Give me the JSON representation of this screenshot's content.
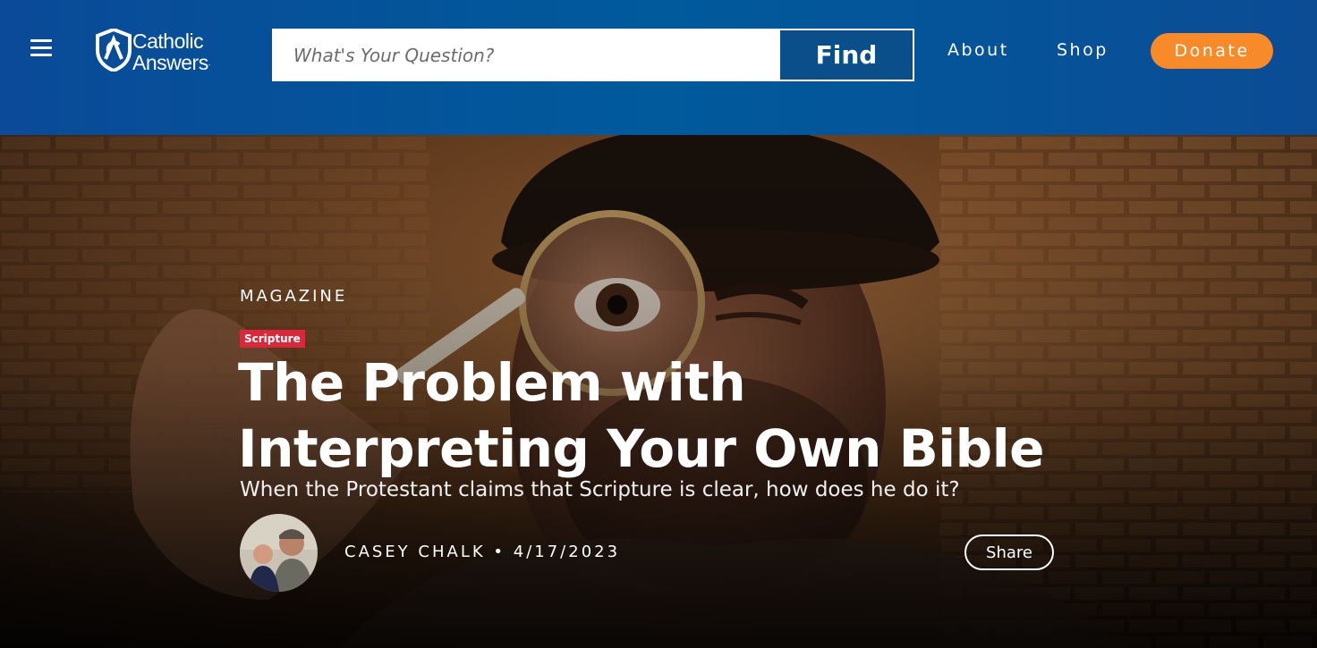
{
  "header": {
    "logo_line1": "Catholic",
    "logo_line2": "Answers",
    "logo_tm": ".",
    "search_placeholder": "What's Your Question?",
    "search_value": "",
    "find_label": "Find",
    "nav": {
      "about": "About",
      "shop": "Shop",
      "donate": "Donate"
    },
    "colors": {
      "header_bg": "#0b5196",
      "donate": "#f98a2a",
      "find_bg": "#0b4f8a"
    }
  },
  "article": {
    "section": "MAGAZINE",
    "tag": "Scripture",
    "tag_color": "#d8283c",
    "title": "The Problem with Interpreting Your Own Bible",
    "subtitle": "When the Protestant claims that Scripture is clear, how does he do it?",
    "author": "CASEY CHALK",
    "separator": "•",
    "date": "4/17/2023",
    "share_label": "Share"
  },
  "icons": [
    "menu-icon",
    "logo-mark-icon",
    "magnifying-glass-hero-image"
  ]
}
